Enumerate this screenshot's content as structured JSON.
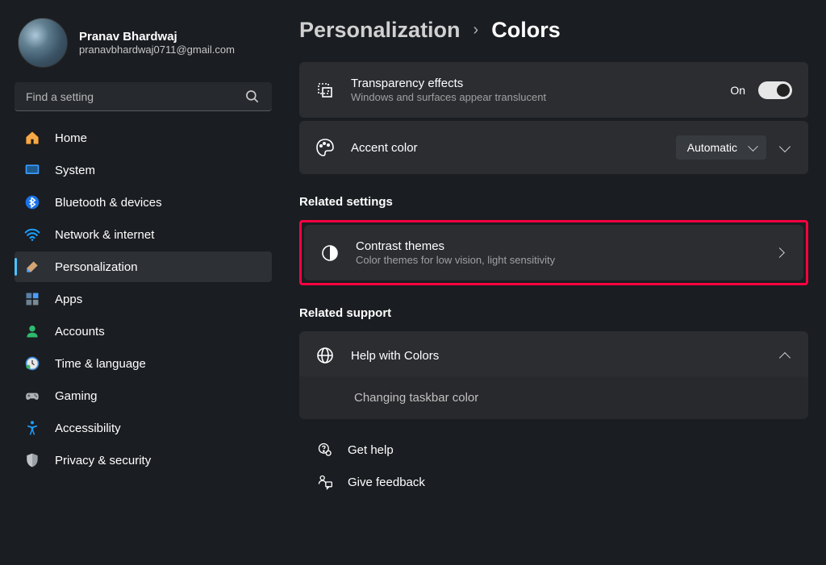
{
  "user": {
    "name": "Pranav Bhardwaj",
    "email": "pranavbhardwaj0711@gmail.com"
  },
  "search": {
    "placeholder": "Find a setting"
  },
  "sidebar": {
    "items": [
      {
        "label": "Home"
      },
      {
        "label": "System"
      },
      {
        "label": "Bluetooth & devices"
      },
      {
        "label": "Network & internet"
      },
      {
        "label": "Personalization"
      },
      {
        "label": "Apps"
      },
      {
        "label": "Accounts"
      },
      {
        "label": "Time & language"
      },
      {
        "label": "Gaming"
      },
      {
        "label": "Accessibility"
      },
      {
        "label": "Privacy & security"
      }
    ]
  },
  "breadcrumb": {
    "parent": "Personalization",
    "current": "Colors"
  },
  "transparency": {
    "title": "Transparency effects",
    "sub": "Windows and surfaces appear translucent",
    "state": "On"
  },
  "accent": {
    "title": "Accent color",
    "value": "Automatic"
  },
  "related_settings": {
    "heading": "Related settings"
  },
  "contrast": {
    "title": "Contrast themes",
    "sub": "Color themes for low vision, light sensitivity"
  },
  "related_support": {
    "heading": "Related support"
  },
  "help_colors": {
    "title": "Help with Colors",
    "item": "Changing taskbar color"
  },
  "links": {
    "get_help": "Get help",
    "feedback": "Give feedback"
  }
}
